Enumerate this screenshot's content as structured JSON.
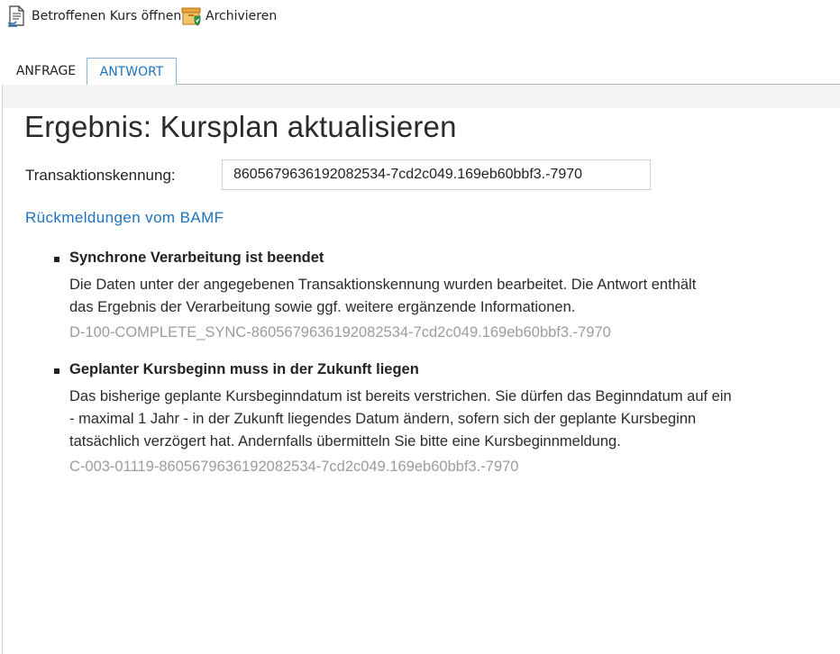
{
  "toolbar": {
    "open_course_label": "Betroffenen Kurs öffnen",
    "open_course_icon": "document-icon",
    "archive_label": "Archivieren",
    "archive_icon": "archive-shield-icon"
  },
  "tabs": [
    {
      "label": "ANFRAGE",
      "active": false
    },
    {
      "label": "ANTWORT",
      "active": true
    }
  ],
  "result": {
    "title": "Ergebnis: Kursplan aktualisieren",
    "transaction_label": "Transaktionskennung:",
    "transaction_id": "8605679636192082534-7cd2c049.169eb60bbf3.-7970",
    "feedback_title": "Rückmeldungen vom BAMF",
    "messages": [
      {
        "heading": "Synchrone Verarbeitung ist beendet",
        "lines": [
          "Die Daten unter der angegebenen Transaktionskennung wurden bearbeitet. Die Antwort enthält",
          "das Ergebnis der Verarbeitung sowie ggf. weitere ergänzende Informationen."
        ],
        "code": "D-100-COMPLETE_SYNC-8605679636192082534-7cd2c049.169eb60bbf3.-7970"
      },
      {
        "heading": "Geplanter Kursbeginn muss in der Zukunft liegen",
        "lines": [
          "Das bisherige geplante Kursbeginndatum ist bereits verstrichen. Sie dürfen das Beginndatum auf ein",
          "- maximal 1 Jahr - in der Zukunft liegendes Datum ändern, sofern sich der geplante Kursbeginn",
          "tatsächlich verzögert hat. Andernfalls übermitteln Sie bitte eine Kursbeginnmeldung."
        ],
        "code": "C-003-01119-8605679636192082534-7cd2c049.169eb60bbf3.-7970"
      }
    ]
  },
  "colors": {
    "accent": "#1e73be",
    "code_gray": "#9c9c9c"
  }
}
